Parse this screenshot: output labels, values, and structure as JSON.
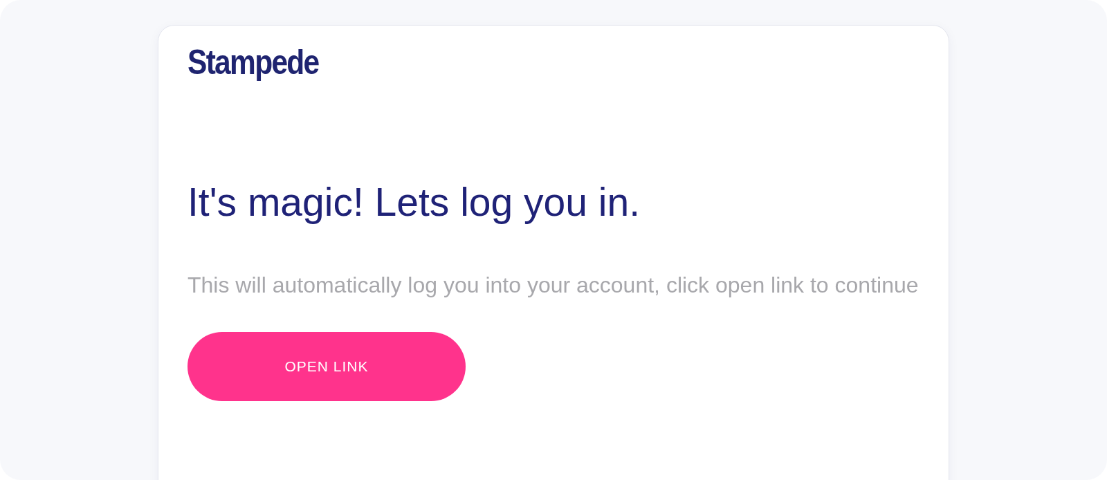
{
  "logo": "Stampede",
  "heading": "It's magic! Lets log you in.",
  "message": "This will automatically log you into your account, click open link to continue",
  "button": "OPEN LINK"
}
